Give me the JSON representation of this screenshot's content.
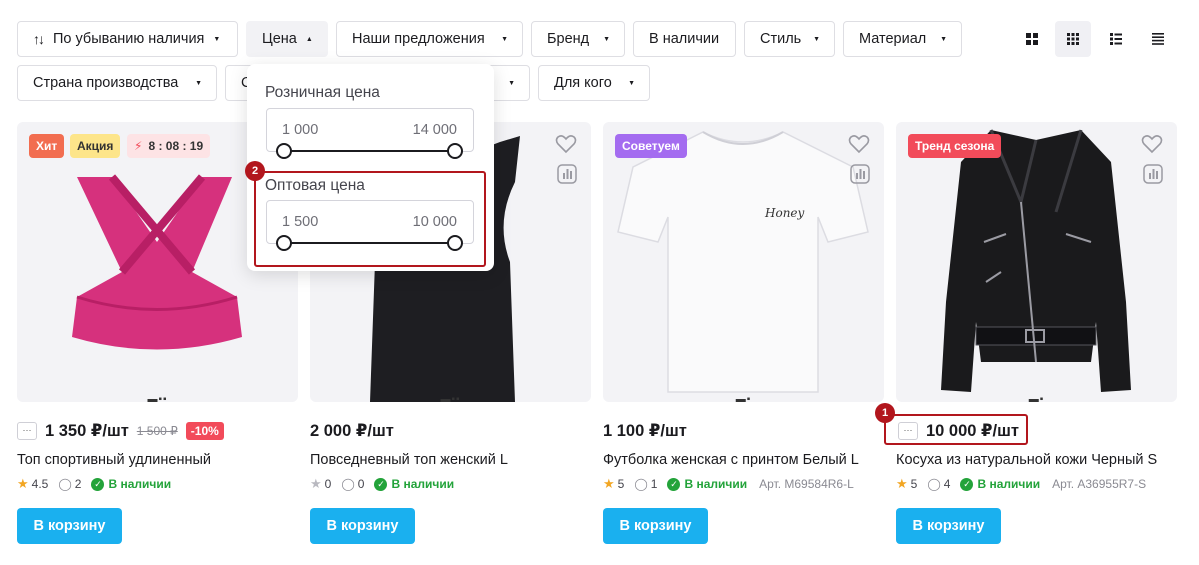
{
  "filters": {
    "sort": "По убыванию наличия",
    "price": "Цена",
    "offers": "Наши предложения",
    "brand": "Бренд",
    "in_stock": "В наличии",
    "style": "Стиль",
    "material": "Материал",
    "country": "Страна производства",
    "country_partial": "С",
    "for_whom": "Для кого"
  },
  "price_popup": {
    "retail_label": "Розничная цена",
    "retail_min": "1 000",
    "retail_max": "14 000",
    "wholesale_label": "Оптовая цена",
    "wholesale_min": "1 500",
    "wholesale_max": "10 000"
  },
  "markers": {
    "m1": "1",
    "m2": "2"
  },
  "products": [
    {
      "badges": [
        "Хит",
        "Акция"
      ],
      "timer": "8 : 08 : 19",
      "more": "···",
      "price": "1 350 ₽/шт",
      "old_price": "1 500 ₽",
      "discount": "-10%",
      "title": "Топ спортивный удлиненный",
      "rating": "4.5",
      "comments": "2",
      "stock": "В наличии",
      "article": "",
      "cart": "В корзину"
    },
    {
      "price": "2 000 ₽/шт",
      "title": "Повседневный топ женский L",
      "rating": "0",
      "comments": "0",
      "stock": "В наличии",
      "cart": "В корзину"
    },
    {
      "badge": "Советуем",
      "price": "1 100 ₽/шт",
      "title": "Футболка женская с принтом Белый L",
      "rating": "5",
      "comments": "1",
      "stock": "В наличии",
      "article": "Арт. M69584R6-L",
      "print_text": "Honey",
      "cart": "В корзину"
    },
    {
      "badge": "Тренд сезона",
      "more": "···",
      "price": "10 000 ₽/шт",
      "title": "Косуха из натуральной кожи Черный S",
      "rating": "5",
      "comments": "4",
      "stock": "В наличии",
      "article": "Арт. A36955R7-S",
      "cart": "В корзину"
    }
  ],
  "colors": {
    "accent": "#1ab0ef",
    "hit": "#f26d50",
    "promo": "#fde58a",
    "recommend": "#a46cf0",
    "trend": "#f24b5a",
    "instock": "#23a33a",
    "highlight": "#b2161d"
  }
}
